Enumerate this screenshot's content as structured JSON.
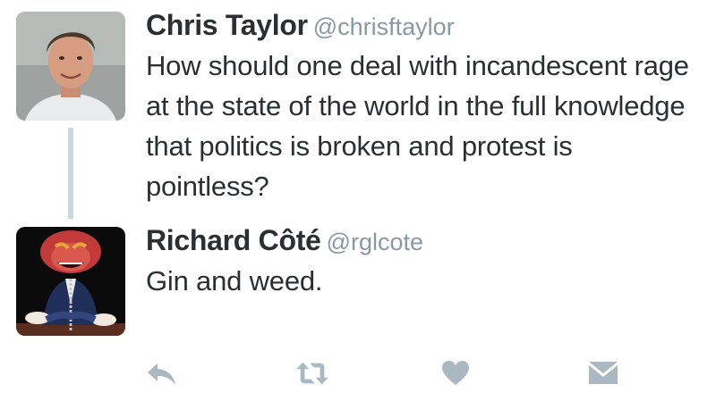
{
  "colors": {
    "name_text": "#292f33",
    "handle_text": "#8899a6",
    "thread_line": "#ccd6dd",
    "action_icon": "#aab8c2"
  },
  "tweets": [
    {
      "display_name": "Chris Taylor",
      "handle": "@chrisftaylor",
      "text": "How should one deal with incandescent rage at the state of the world in the full knowledge that politics is broken and protest is pointless?",
      "avatar_icon": "user-photo-avatar"
    },
    {
      "display_name": "Richard Côté",
      "handle": "@rglcote",
      "text": "Gin and weed.",
      "avatar_icon": "muppet-animal-avatar"
    }
  ],
  "actions": [
    {
      "icon": "reply-icon"
    },
    {
      "icon": "retweet-icon"
    },
    {
      "icon": "heart-icon"
    },
    {
      "icon": "direct-message-icon"
    }
  ]
}
